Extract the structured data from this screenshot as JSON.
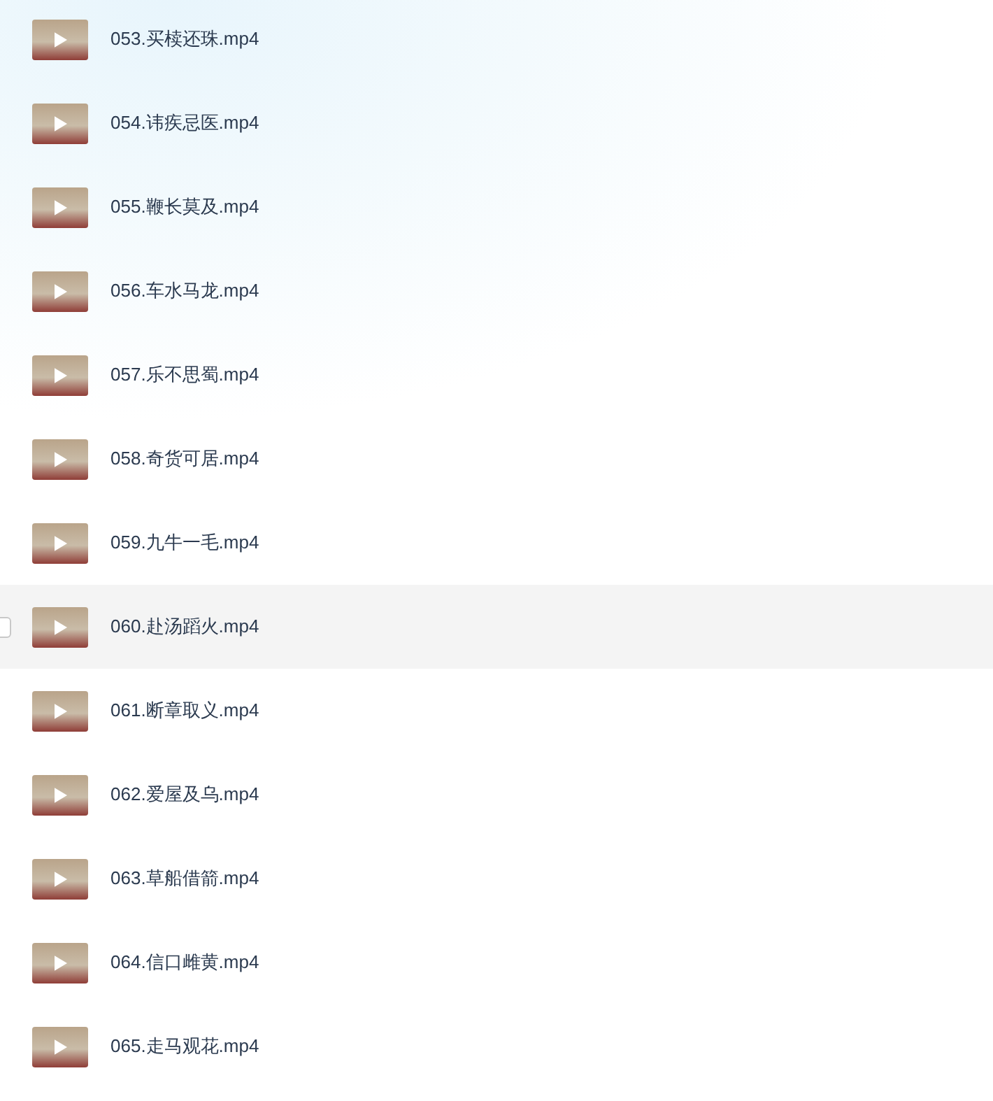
{
  "files": [
    {
      "name": "053.买椟还珠.mp4",
      "hovered": false
    },
    {
      "name": "054.讳疾忌医.mp4",
      "hovered": false
    },
    {
      "name": "055.鞭长莫及.mp4",
      "hovered": false
    },
    {
      "name": "056.车水马龙.mp4",
      "hovered": false
    },
    {
      "name": "057.乐不思蜀.mp4",
      "hovered": false
    },
    {
      "name": "058.奇货可居.mp4",
      "hovered": false
    },
    {
      "name": "059.九牛一毛.mp4",
      "hovered": false
    },
    {
      "name": "060.赴汤蹈火.mp4",
      "hovered": true
    },
    {
      "name": "061.断章取义.mp4",
      "hovered": false
    },
    {
      "name": "062.爱屋及乌.mp4",
      "hovered": false
    },
    {
      "name": "063.草船借箭.mp4",
      "hovered": false
    },
    {
      "name": "064.信口雌黄.mp4",
      "hovered": false
    },
    {
      "name": "065.走马观花.mp4",
      "hovered": false
    }
  ]
}
